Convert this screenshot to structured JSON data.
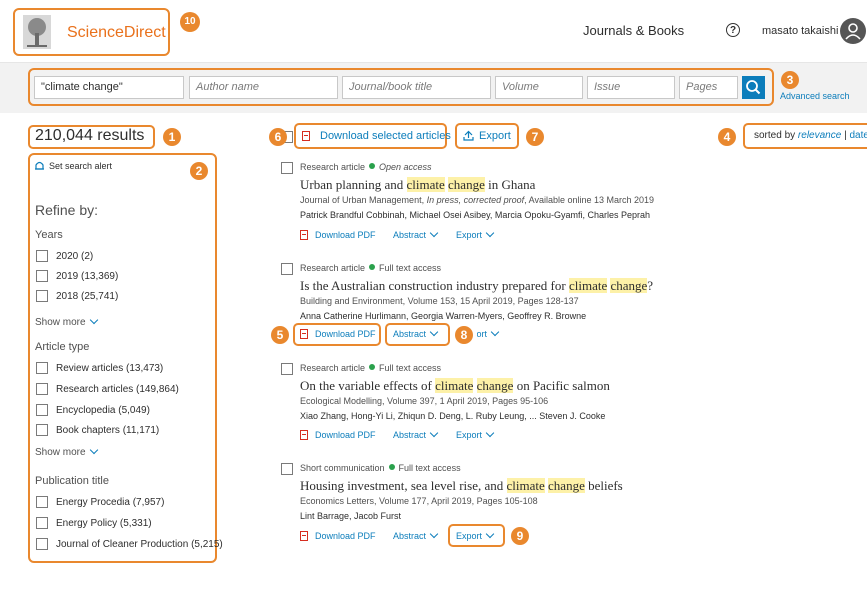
{
  "header": {
    "brand": "ScienceDirect",
    "journals_books": "Journals & Books",
    "help": "?",
    "user": "masato takaishi"
  },
  "search": {
    "keywords": "\"climate change\"",
    "author_placeholder": "Author name",
    "journal_placeholder": "Journal/book title",
    "volume_placeholder": "Volume",
    "issue_placeholder": "Issue",
    "pages_placeholder": "Pages",
    "advanced": "Advanced search"
  },
  "results_count": "210,044 results",
  "toolbar": {
    "download_selected": "Download selected articles",
    "export": "Export",
    "sorted_by": "sorted by",
    "relevance": "relevance",
    "sep": "|",
    "date": "date"
  },
  "refine": {
    "alert": "Set search alert",
    "title": "Refine by:",
    "years_heading": "Years",
    "years": [
      "2020 (2)",
      "2019 (13,369)",
      "2018 (25,741)"
    ],
    "show_more": "Show more",
    "type_heading": "Article type",
    "types": [
      "Review articles (13,473)",
      "Research articles (149,864)",
      "Encyclopedia (5,049)",
      "Book chapters (11,171)"
    ],
    "pub_heading": "Publication title",
    "pubs": [
      "Energy Procedia (7,957)",
      "Energy Policy (5,331)",
      "Journal of Cleaner Production (5,215)"
    ]
  },
  "actions": {
    "download_pdf": "Download PDF",
    "abstract": "Abstract",
    "export": "Export"
  },
  "results": [
    {
      "type": "Research article",
      "access": "Open access",
      "title_a": "Urban planning and ",
      "title_hl1": "climate",
      "title_b": " ",
      "title_hl2": "change",
      "title_c": " in Ghana",
      "source_a": "Journal of Urban Management, ",
      "source_i": "In press, corrected proof",
      "source_b": ", Available online 13 March 2019",
      "authors": "Patrick Brandful Cobbinah, Michael Osei Asibey, Marcia Opoku-Gyamfi, Charles Peprah"
    },
    {
      "type": "Research article",
      "access": "Full text access",
      "title_a": "Is the Australian construction industry prepared for ",
      "title_hl1": "climate",
      "title_b": " ",
      "title_hl2": "change",
      "title_c": "?",
      "source": "Building and Environment, Volume 153, 15 April 2019, Pages 128-137",
      "authors": "Anna Catherine Hurlimann, Georgia Warren-Myers, Geoffrey R. Browne"
    },
    {
      "type": "Research article",
      "access": "Full text access",
      "title_a": "On the variable effects of ",
      "title_hl1": "climate",
      "title_b": " ",
      "title_hl2": "change",
      "title_c": " on Pacific salmon",
      "source": "Ecological Modelling, Volume 397, 1 April 2019, Pages 95-106",
      "authors": "Xiao Zhang, Hong-Yi Li, Zhiqun D. Deng, L. Ruby Leung, ... Steven J. Cooke"
    },
    {
      "type": "Short communication",
      "access": "Full text access",
      "title_a": "Housing investment, sea level rise, and ",
      "title_hl1": "climate",
      "title_b": " ",
      "title_hl2": "change",
      "title_c": " beliefs",
      "source": "Economics Letters, Volume 177, April 2019, Pages 105-108",
      "authors": "Lint Barrage, Jacob Furst"
    }
  ],
  "callouts": [
    "1",
    "2",
    "3",
    "4",
    "5",
    "6",
    "7",
    "8",
    "9",
    "10"
  ]
}
